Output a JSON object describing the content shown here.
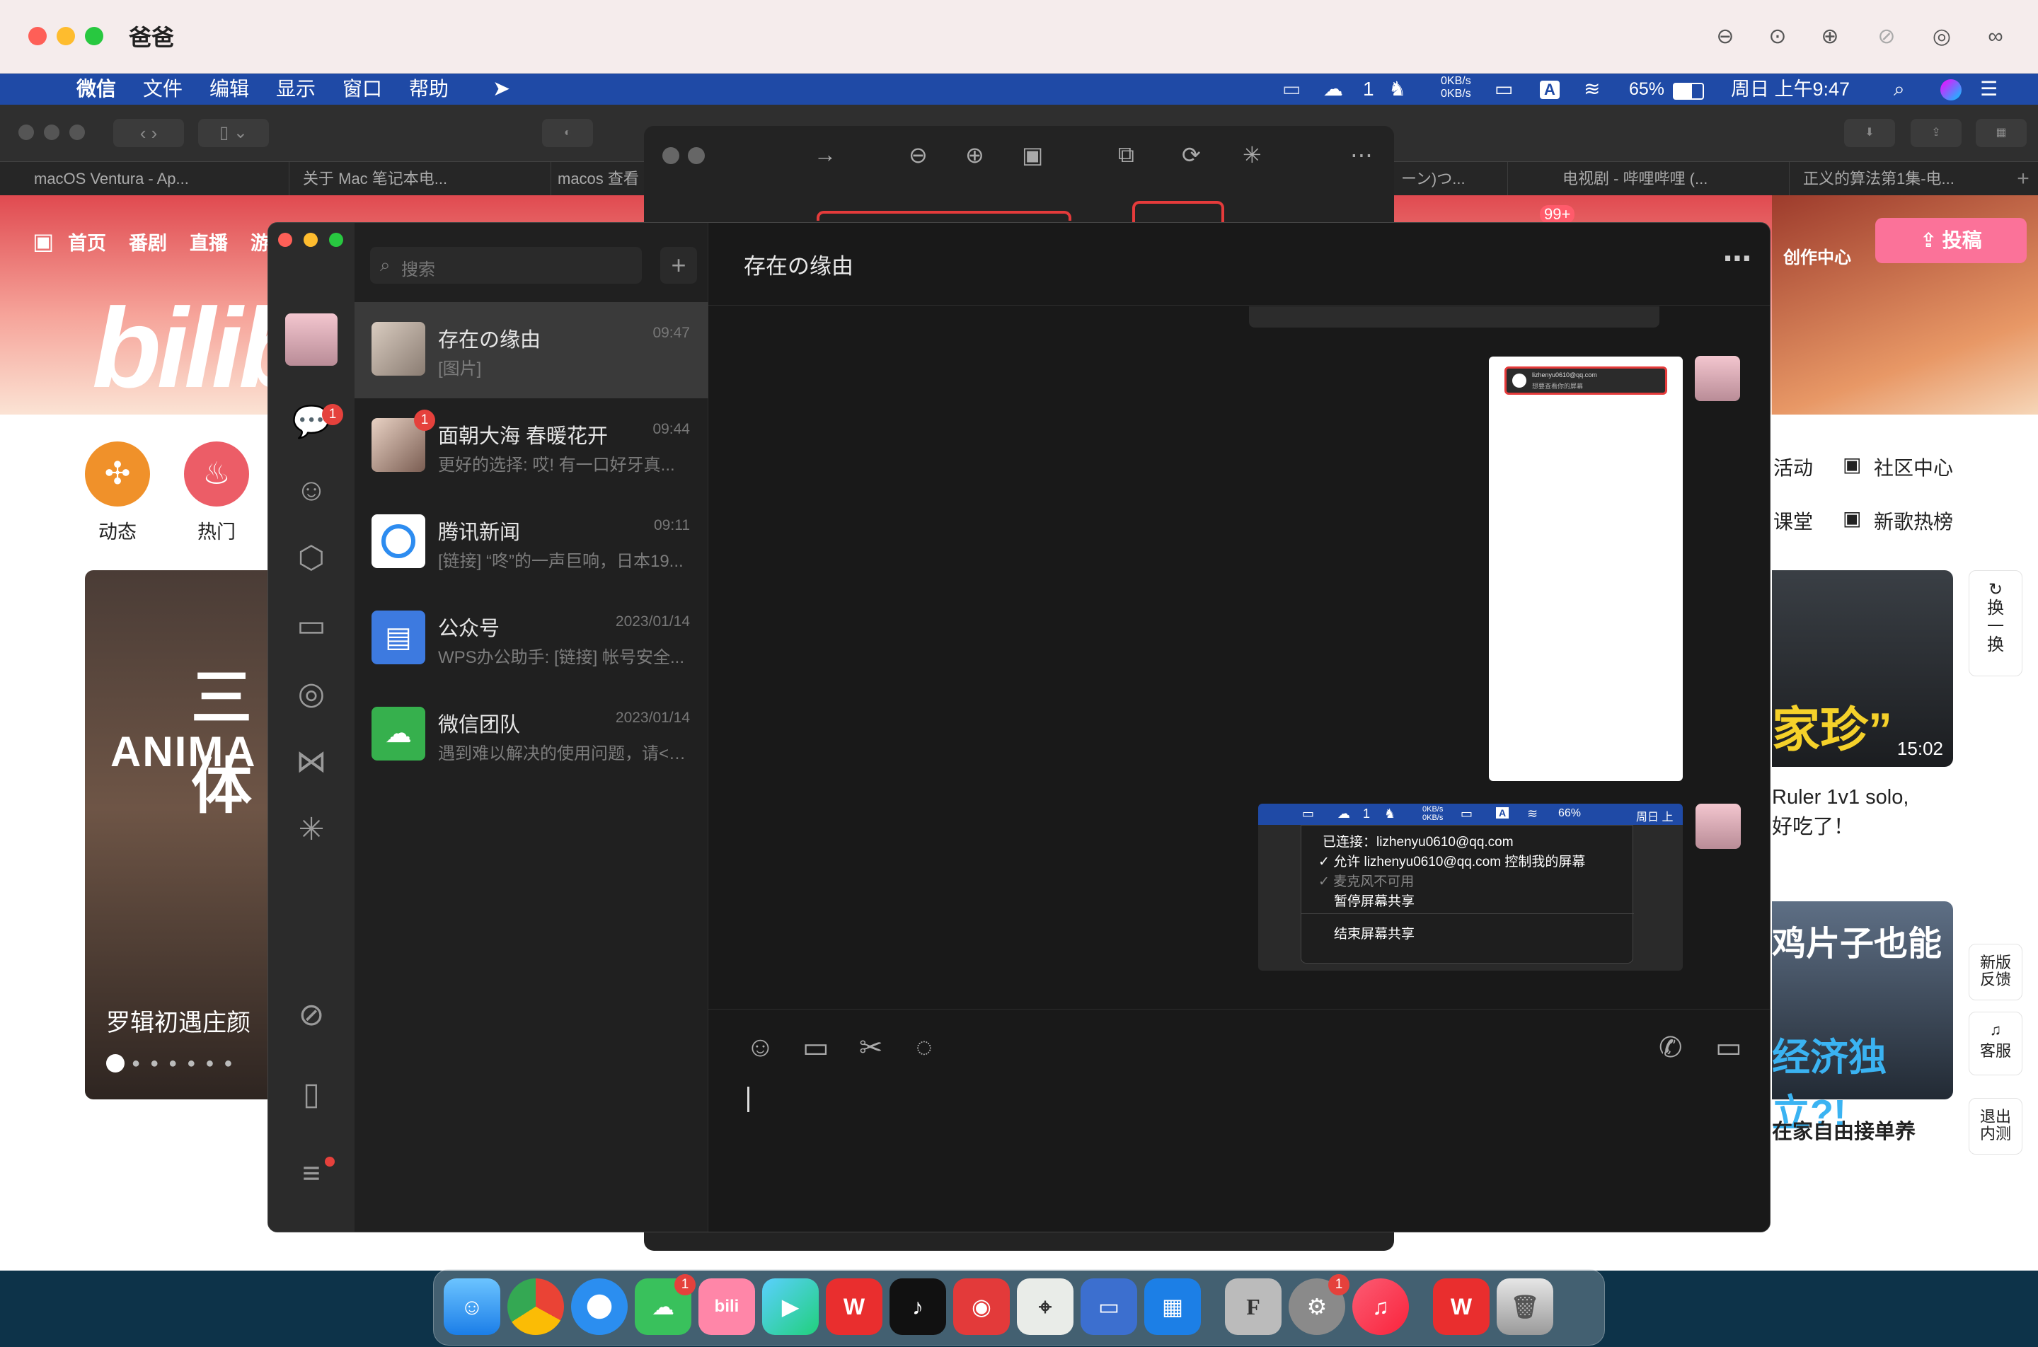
{
  "viewer": {
    "title": "爸爸",
    "tools": [
      "zoom-out-icon",
      "zoom-actual-icon",
      "zoom-in-icon",
      "zoom-fit-icon",
      "remote-control-icon",
      "binoculars-icon"
    ]
  },
  "menubar": {
    "items": [
      "微信",
      "文件",
      "编辑",
      "显示",
      "窗口",
      "帮助"
    ],
    "status": {
      "wechat_count": "1",
      "net_up": "0KB/s",
      "net_down": "0KB/s",
      "input": "A",
      "battery": "65%",
      "clock": "周日 上午9:47"
    }
  },
  "safari": {
    "tabs": [
      "macOS Ventura - Ap...",
      "关于 Mac 笔记本电...",
      "macos 查看",
      "ーン)つ...",
      "电视剧 - 哔哩哔哩 (...",
      "正义的算法第1集-电..."
    ]
  },
  "bilibili": {
    "nav": [
      "首页",
      "番剧",
      "直播",
      "游"
    ],
    "logo": "bilib",
    "upload": "投稿",
    "creator": "创作中心",
    "badge": "99+",
    "quick": [
      {
        "label": "动态",
        "icon": "✣",
        "color": "#f0912a"
      },
      {
        "label": "热门",
        "icon": "♨",
        "color": "#ec5d67"
      }
    ],
    "right_links": [
      "活动",
      "社区中心",
      "课堂",
      "新歌热榜"
    ],
    "carousel_title": "罗辑初遇庄颜",
    "carousel_art": "ANIMA",
    "carousel_art_zh": "三体",
    "video1_overlay": "家珍”",
    "video1_duration": "15:02",
    "video1_title_line1": "Ruler 1v1 solo,",
    "video1_title_line2": "好吃了！",
    "video2_overlay_line1": "鸡片子也能",
    "video2_overlay_line2": "经济独立?!",
    "video2_title": "在家自由接单养",
    "refresh": [
      "换",
      "一",
      "换"
    ],
    "side": {
      "feedback": "新版\n反馈",
      "service": "客服",
      "exit": "退出\n内测"
    }
  },
  "wechat": {
    "search_placeholder": "搜索",
    "chat_title": "存在の缘由",
    "conversations": [
      {
        "name": "存在の缘由",
        "time": "09:47",
        "preview": "[图片]",
        "active": true
      },
      {
        "name": "面朝大海 春暖花开",
        "time": "09:44",
        "preview": "更好的选择: 哎! 有一口好牙真...",
        "badge": "1"
      },
      {
        "name": "腾讯新闻",
        "time": "09:11",
        "preview": "[链接] “咚”的一声巨响，日本19..."
      },
      {
        "name": "公众号",
        "time": "2023/01/14",
        "preview": "WPS办公助手: [链接] 帐号安全..."
      },
      {
        "name": "微信团队",
        "time": "2023/01/14",
        "preview": "遇到难以解决的使用问题，请<a..."
      }
    ],
    "sidebar_badge": "1",
    "shot_email": "lizhenyu0610@qq.com",
    "shot_tiny_menu": "想要查看你的屏幕",
    "shot_menu": {
      "status": {
        "wechat": "1",
        "net_up": "0KB/s",
        "net_down": "0KB/s",
        "input": "A",
        "battery": "66%",
        "clock": "周日 上"
      },
      "items": [
        "已连接：lizhenyu0610@qq.com",
        "✓ 允许 lizhenyu0610@qq.com 控制我的屏幕",
        "✓ 麦克风不可用",
        "暂停屏幕共享",
        "结束屏幕共享"
      ]
    }
  }
}
